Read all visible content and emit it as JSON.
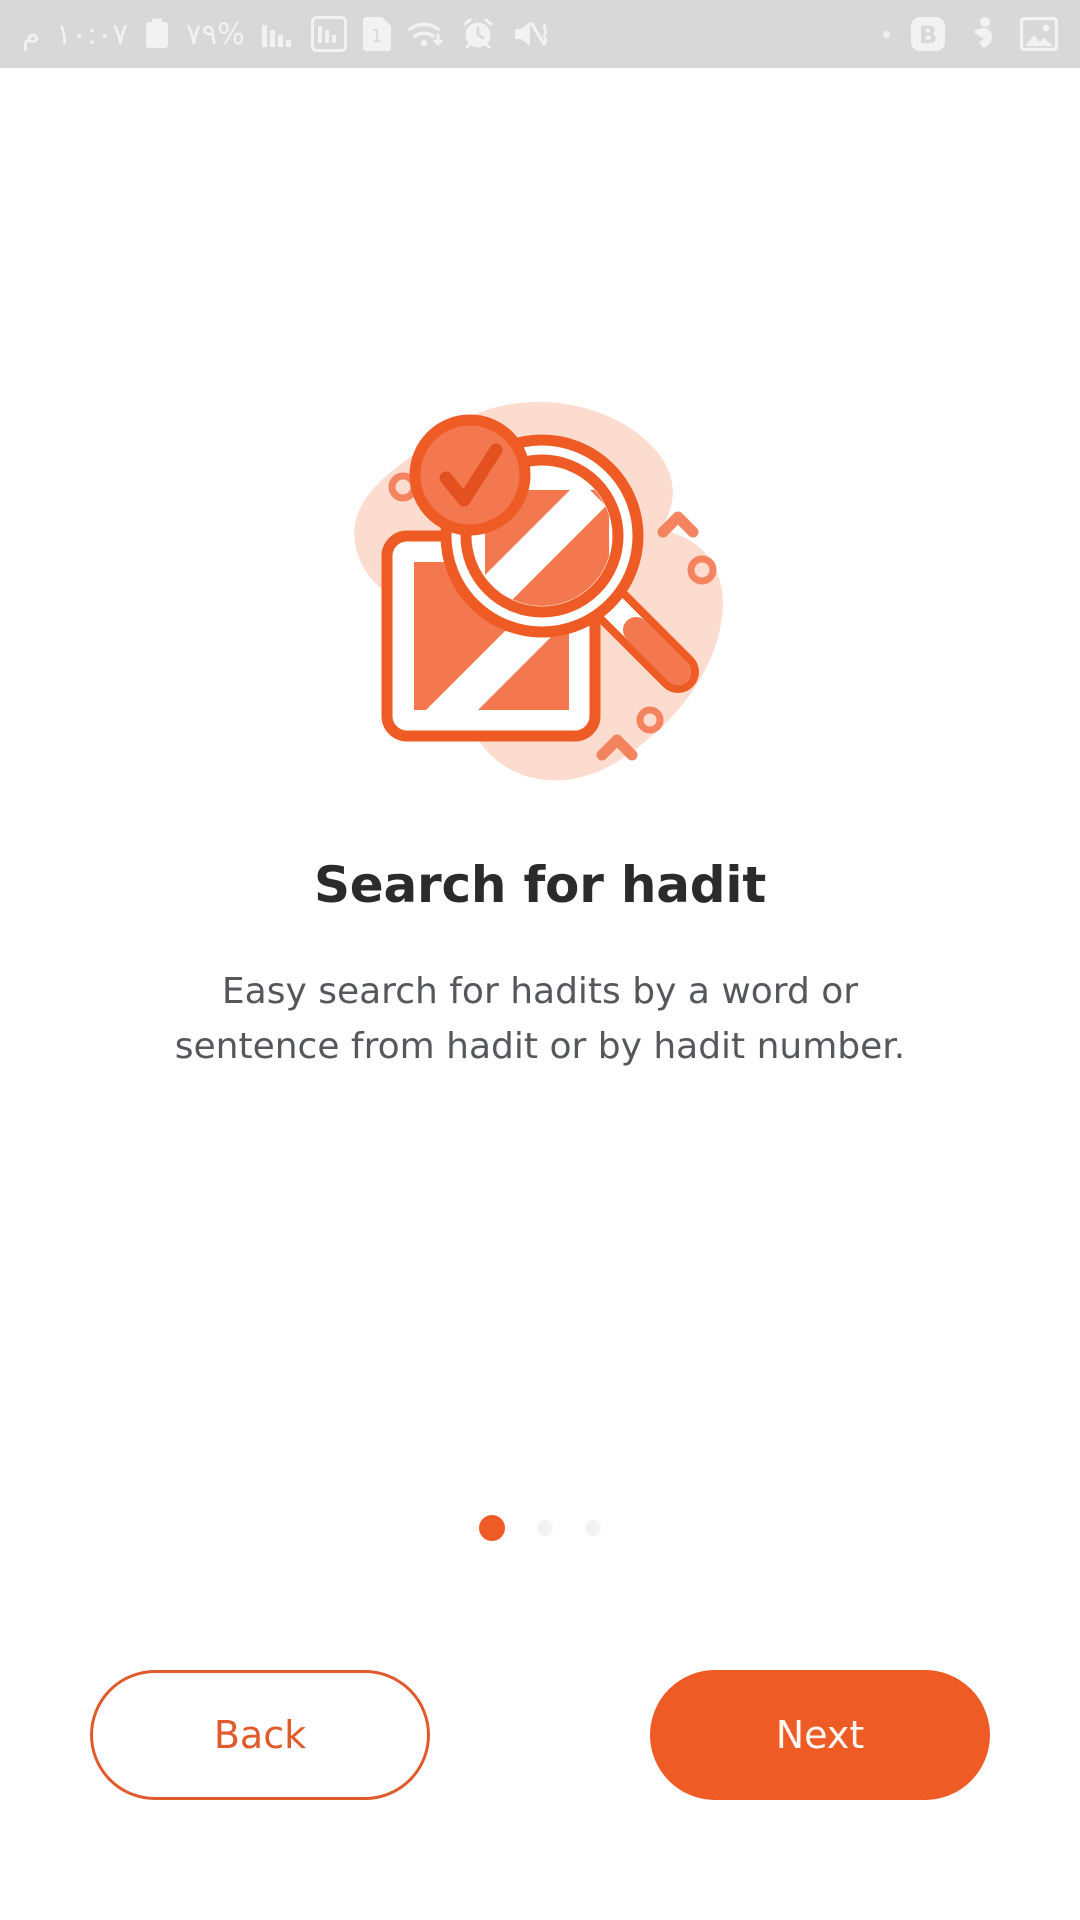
{
  "status_bar": {
    "background": "#d8d8d8",
    "icon_color": "#f2f2f2",
    "time": "١٠:٠٧",
    "meridiem": "م",
    "battery_percent": "٧٩%",
    "left_icons": [
      {
        "name": "clipboard-icon",
        "label": "clipboard"
      },
      {
        "name": "signal-bars-icon",
        "label": "signal-strength"
      },
      {
        "name": "signal-bars-boxed-icon",
        "label": "signal-strength-sim2"
      },
      {
        "name": "sim-one-icon",
        "label": "sim-1"
      },
      {
        "name": "wifi-data-icon",
        "label": "wifi-transfer"
      },
      {
        "name": "alarm-clock-icon",
        "label": "alarm"
      },
      {
        "name": "mute-vibrate-icon",
        "label": "sound-muted"
      }
    ],
    "right_icons": [
      {
        "name": "notification-dot-icon",
        "label": "notification"
      },
      {
        "name": "bold-b-badge-icon",
        "label": "b-app"
      },
      {
        "name": "person-activity-icon",
        "label": "activity"
      },
      {
        "name": "photo-image-icon",
        "label": "gallery"
      }
    ]
  },
  "illustration": {
    "name": "search-document-magnifier-illustration",
    "alt": "Document with magnifying glass and check badge",
    "colors": {
      "blob": "#fcdccf",
      "blob_light": "#fde6dc",
      "primary": "#ef5b25",
      "primary_dark": "#e2511f",
      "fill_light": "#f4784f",
      "accent": "#f07a52",
      "white": "#ffffff"
    }
  },
  "content": {
    "title": "Search for hadit",
    "subtitle": "Easy search for hadits by a word or sentence from hadit or by hadit number."
  },
  "pager": {
    "total": 3,
    "active_index": 0,
    "active_color": "#ef5b25",
    "inactive_color": "#f3f3f3"
  },
  "footer": {
    "back_label": "Back",
    "next_label": "Next",
    "back_color": "#e05a2b",
    "next_background": "#ef5b25",
    "next_text_color": "#fff7f3"
  }
}
